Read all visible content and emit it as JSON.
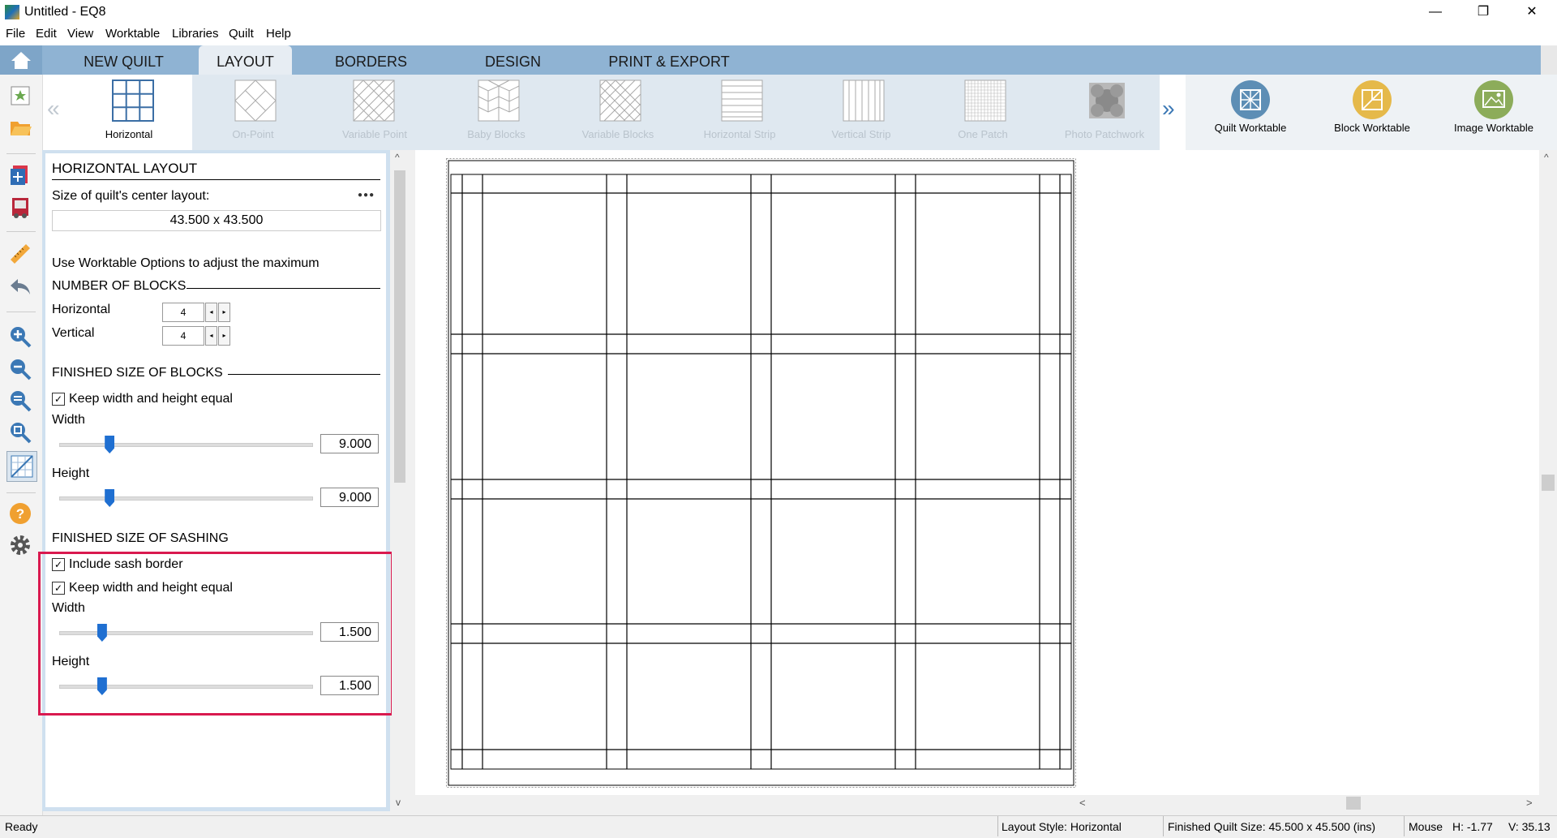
{
  "window": {
    "title": "Untitled - EQ8",
    "minimize": "—",
    "restore": "❐",
    "close": "✕"
  },
  "menu": [
    "File",
    "Edit",
    "View",
    "Worktable",
    "Libraries",
    "Quilt",
    "Help"
  ],
  "tabs": [
    "NEW QUILT",
    "LAYOUT",
    "BORDERS",
    "DESIGN",
    "PRINT & EXPORT"
  ],
  "ribbon": {
    "prev": "«",
    "next": "»",
    "layouts": [
      "Horizontal",
      "On-Point",
      "Variable Point",
      "Baby Blocks",
      "Variable Blocks",
      "Horizontal Strip",
      "Vertical Strip",
      "One Patch",
      "Photo Patchwork"
    ],
    "worktables": [
      "Quilt Worktable",
      "Block Worktable",
      "Image Worktable"
    ],
    "worktable_colors": [
      "#5d8eb5",
      "#e5b94a",
      "#8cac5a"
    ]
  },
  "panel": {
    "heading": "HORIZONTAL LAYOUT",
    "size_label": "Size of quilt's center layout:",
    "more": "●●●",
    "size_value": "43.500 x 43.500",
    "hint": "Use Worktable Options to adjust the maximum",
    "blocks_section": "NUMBER OF BLOCKS",
    "horizontal_label": "Horizontal",
    "horizontal_value": "4",
    "vertical_label": "Vertical",
    "vertical_value": "4",
    "spin_left": "◂",
    "spin_right": "▸",
    "block_size_section": "FINISHED SIZE OF BLOCKS",
    "keep_equal": "Keep width and height equal",
    "width_label": "Width",
    "block_width": "9.000",
    "block_width_pct": 0.2,
    "height_label": "Height",
    "block_height": "9.000",
    "block_height_pct": 0.2,
    "sash_section": "FINISHED SIZE OF SASHING",
    "include_sash": "Include sash border",
    "sash_keep_equal": "Keep width and height equal",
    "sash_width_label": "Width",
    "sash_width": "1.500",
    "sash_width_pct": 0.17,
    "sash_height_label": "Height",
    "sash_height": "1.500",
    "sash_height_pct": 0.17,
    "check": "✓"
  },
  "status": {
    "ready": "Ready",
    "layout_style": "Layout Style: Horizontal",
    "finished_size": "Finished Quilt Size: 45.500 x 45.500 (ins)",
    "mouse": "Mouse",
    "h": "H:  -1.77",
    "v": "V:  35.13"
  },
  "scroll": {
    "up": "^",
    "down": "v",
    "left": "<",
    "right": ">"
  }
}
